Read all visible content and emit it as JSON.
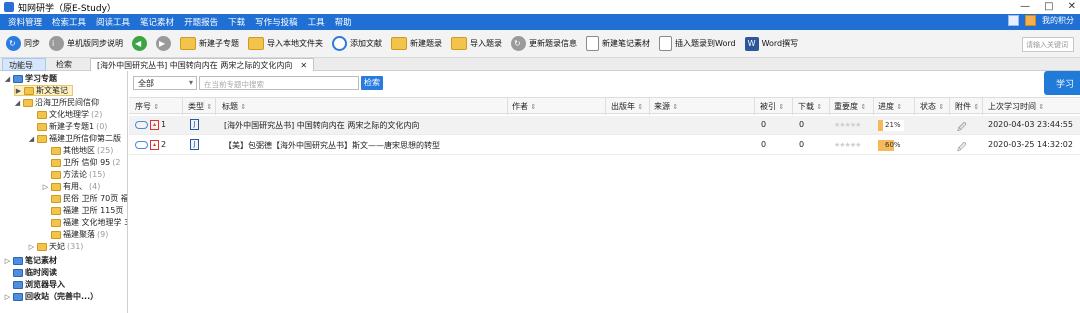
{
  "window": {
    "title": "知网研学（原E-Study）",
    "controls": [
      "—",
      "□",
      "✕"
    ]
  },
  "menu": {
    "items": [
      "资料管理",
      "检索工具",
      "阅读工具",
      "笔记素材",
      "开题报告",
      "下载",
      "写作与投稿",
      "工具",
      "帮助"
    ],
    "my_points": "我的积分"
  },
  "toolbar": {
    "sync": "同步",
    "single_sync": "单机版同步说明",
    "new_subtopic": "新建子专题",
    "import_local": "导入本地文件夹",
    "add_doc": "添加文献",
    "new_record": "新建题录",
    "import_record": "导入题录",
    "update_record": "更新题录信息",
    "new_note": "新建笔记素材",
    "insert_word": "插入题录到Word",
    "word_write": "Word撰写",
    "search_placeholder": "请输入关键词"
  },
  "tabs": {
    "nav": "功能导航",
    "search": "检索",
    "doc_tab": "[海外中国研究丛书] 中国转向内在 两宋之际的文化内向",
    "close": "✕"
  },
  "sidebar": {
    "nodes": [
      {
        "label": "学习专题",
        "count": "",
        "level": 0
      },
      {
        "label": "斯文笔记",
        "count": "",
        "level": 1
      },
      {
        "label": "沿海卫所民间信仰",
        "count": "",
        "level": 1
      },
      {
        "label": "文化地理学",
        "count": "(2)",
        "level": 2
      },
      {
        "label": "新建子专题1",
        "count": "(0)",
        "level": 2
      },
      {
        "label": "福建卫所信仰第二版",
        "count": "",
        "level": 2
      },
      {
        "label": "其他地区",
        "count": "(25)",
        "level": 3
      },
      {
        "label": "卫所 信仰 95",
        "count": "(2",
        "level": 3
      },
      {
        "label": "方法论",
        "count": "(15)",
        "level": 3
      },
      {
        "label": "有用、",
        "count": "(4)",
        "level": 3
      },
      {
        "label": "民俗 卫所 70页 福建",
        "count": "",
        "level": 3
      },
      {
        "label": "福建 卫所 115页",
        "count": "",
        "level": 3
      },
      {
        "label": "福建 文化地理学 36",
        "count": "",
        "level": 3
      },
      {
        "label": "福建聚落",
        "count": "(9)",
        "level": 3
      },
      {
        "label": "天妃",
        "count": "(31)",
        "level": 2
      },
      {
        "label": "笔记素材",
        "count": "",
        "level": 0
      },
      {
        "label": "临时阅读",
        "count": "",
        "level": 0
      },
      {
        "label": "浏览器导入",
        "count": "",
        "level": 0
      },
      {
        "label": "回收站（完善中...）",
        "count": "",
        "level": 0
      }
    ]
  },
  "filter": {
    "scope": "全部",
    "placeholder": "在当前专题中搜索",
    "search_btn": "检索",
    "learn_btn": "学习"
  },
  "grid": {
    "columns": [
      "序号",
      "类型",
      "标题",
      "作者",
      "出版年",
      "来源",
      "被引",
      "下载",
      "重要度",
      "进度",
      "状态",
      "附件",
      "上次学习时间"
    ],
    "rows": [
      {
        "index": "1",
        "title": "[海外中国研究丛书] 中国转向内在 两宋之际的文化内向",
        "author": "",
        "year": "",
        "source": "",
        "cited": "0",
        "downloads": "0",
        "stars": "★★★★★",
        "progress": 0.21,
        "progress_text": "21%",
        "last_study": "2020-04-03 23:44:55"
      },
      {
        "index": "2",
        "title": "【美】包弼德【海外中国研究丛书】斯文——唐宋思想的转型",
        "author": "",
        "year": "",
        "source": "",
        "cited": "0",
        "downloads": "0",
        "stars": "★★★★★",
        "progress": 0.6,
        "progress_text": "60%",
        "last_study": "2020-03-25 14:32:02"
      }
    ]
  },
  "colors": {
    "menubar": "#1f6fd4",
    "accent": "#2a7be0",
    "progress": "#f6b95a"
  }
}
